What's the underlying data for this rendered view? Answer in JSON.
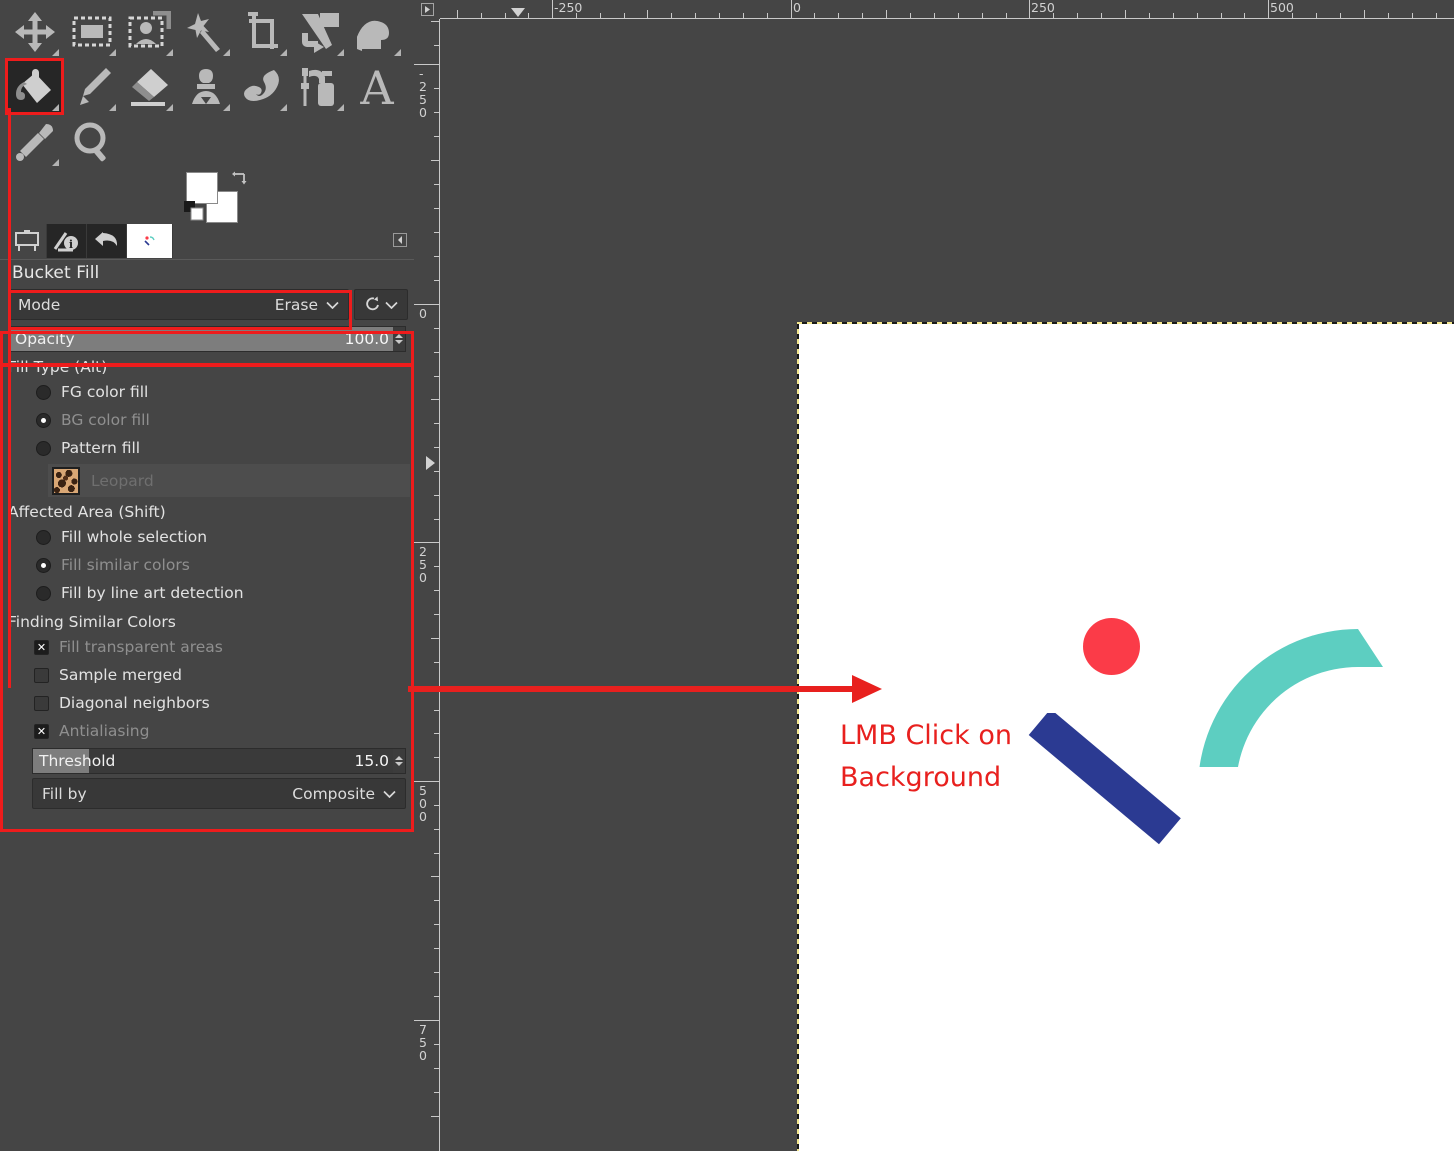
{
  "app": {
    "tool_panel_title": "Bucket Fill"
  },
  "toolbox": {
    "tools": [
      {
        "name": "move-tool",
        "title": "Move"
      },
      {
        "name": "rectangle-select-tool",
        "title": "Rectangle Select"
      },
      {
        "name": "foreground-select-tool",
        "title": "Foreground Select"
      },
      {
        "name": "fuzzy-select-tool",
        "title": "Fuzzy Select"
      },
      {
        "name": "crop-tool",
        "title": "Crop"
      },
      {
        "name": "unified-transform-tool",
        "title": "Unified Transform"
      },
      {
        "name": "warp-transform-tool",
        "title": "Warp Transform"
      },
      {
        "name": "bucket-fill-tool",
        "title": "Bucket Fill"
      },
      {
        "name": "paintbrush-tool",
        "title": "Paintbrush"
      },
      {
        "name": "eraser-tool",
        "title": "Eraser"
      },
      {
        "name": "clone-tool",
        "title": "Clone"
      },
      {
        "name": "smudge-tool",
        "title": "Smudge"
      },
      {
        "name": "airbrush-tool",
        "title": "Airbrush"
      },
      {
        "name": "text-tool",
        "title": "Text"
      },
      {
        "name": "color-picker-tool",
        "title": "Color Picker"
      },
      {
        "name": "zoom-tool",
        "title": "Zoom"
      }
    ],
    "selected_index": 7,
    "foreground_color": "#ffffff",
    "background_color": "#ffffff"
  },
  "dock_tabs": [
    {
      "name": "tool-options-tab",
      "icon": "tool-options-icon"
    },
    {
      "name": "device-status-tab",
      "icon": "device-status-icon"
    },
    {
      "name": "undo-history-tab",
      "icon": "undo-history-icon"
    },
    {
      "name": "images-tab",
      "icon": "image-thumbnail"
    }
  ],
  "tool_options": {
    "mode": {
      "label": "Mode",
      "value": "Erase"
    },
    "reset_icon": "reset-icon",
    "opacity": {
      "label": "Opacity",
      "value": "100.0",
      "percent": 100
    },
    "fill_type": {
      "header": "Fill Type  (Alt)",
      "options": [
        {
          "label": "FG color fill",
          "selected": false,
          "dim": false
        },
        {
          "label": "BG color fill",
          "selected": true,
          "dim": true
        },
        {
          "label": "Pattern fill",
          "selected": false,
          "dim": false
        }
      ],
      "pattern_name": "Leopard"
    },
    "affected_area": {
      "header": "Affected Area  (Shift)",
      "options": [
        {
          "label": "Fill whole selection",
          "selected": false,
          "dim": false
        },
        {
          "label": "Fill similar colors",
          "selected": true,
          "dim": true
        },
        {
          "label": "Fill by line art detection",
          "selected": false,
          "dim": false
        }
      ]
    },
    "finding_similar_colors": {
      "header": "Finding Similar Colors",
      "checkboxes": [
        {
          "label": "Fill transparent areas",
          "checked": true,
          "dim": true
        },
        {
          "label": "Sample merged",
          "checked": false,
          "dim": false
        },
        {
          "label": "Diagonal neighbors",
          "checked": false,
          "dim": false
        },
        {
          "label": "Antialiasing",
          "checked": true,
          "dim": true
        }
      ],
      "threshold": {
        "label": "Threshold",
        "value": "15.0",
        "percent": 15
      },
      "fill_by": {
        "label": "Fill by",
        "value": "Composite"
      }
    }
  },
  "annotation": {
    "text": "LMB Click on\nBackground",
    "color": "#e8201e"
  },
  "canvas": {
    "h_ruler_labels": [
      "-250",
      "0",
      "250",
      "500"
    ],
    "v_ruler_labels": [
      "-250",
      "0",
      "250",
      "500",
      "750"
    ],
    "background_color": "#ffffff",
    "shapes": [
      {
        "name": "red-circle",
        "type": "circle",
        "color": "#fb3b48"
      },
      {
        "name": "teal-arc",
        "type": "arc",
        "color": "#5dcec1"
      },
      {
        "name": "blue-bar",
        "type": "rect",
        "color": "#2b3a92"
      }
    ]
  },
  "colors": {
    "accent_red": "#ee1c1c",
    "panel_bg": "#454545",
    "widget_bg": "#383838"
  }
}
